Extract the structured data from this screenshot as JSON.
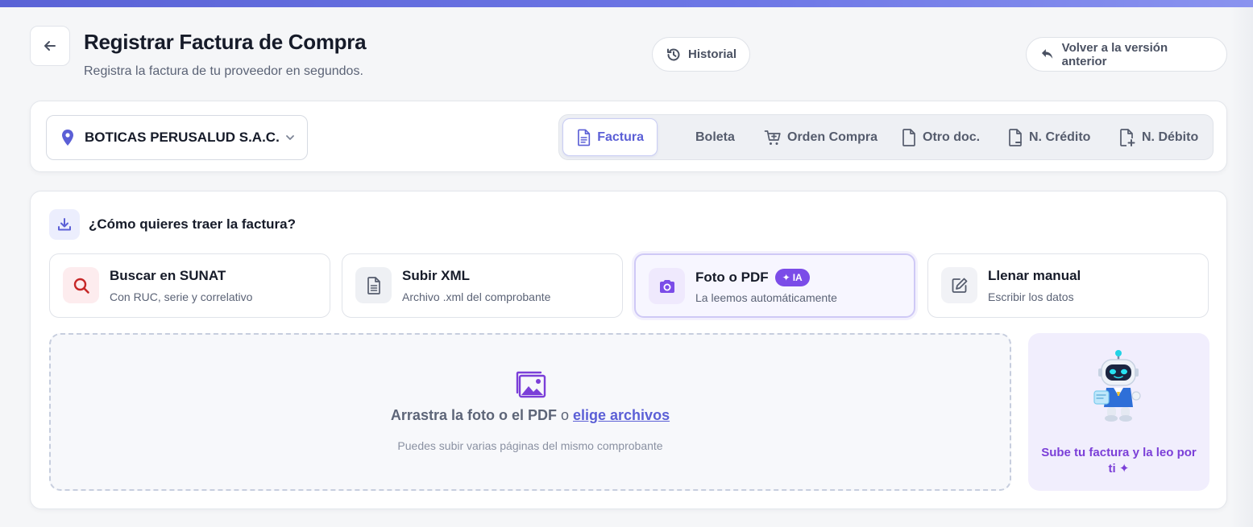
{
  "header": {
    "title": "Registrar Factura de Compra",
    "subtitle": "Registra la factura de tu proveedor en segundos.",
    "history_label": "Historial",
    "revert_label": "Volver a la versión anterior"
  },
  "branch": {
    "name": "BOTICAS PERUSALUD S.A.C."
  },
  "doc_types": [
    {
      "label": "Factura",
      "icon": "document-lines-icon",
      "active": true
    },
    {
      "label": "Boleta",
      "icon": "",
      "active": false
    },
    {
      "label": "Orden Compra",
      "icon": "cart-plus-icon",
      "active": false
    },
    {
      "label": "Otro doc.",
      "icon": "document-icon",
      "active": false
    },
    {
      "label": "N. Crédito",
      "icon": "document-minus-icon",
      "active": false
    },
    {
      "label": "N. Débito",
      "icon": "document-plus-icon",
      "active": false
    }
  ],
  "source": {
    "question": "¿Cómo quieres traer la factura?",
    "methods": [
      {
        "title": "Buscar en SUNAT",
        "subtitle": "Con RUC, serie y correlativo",
        "icon": "search-icon",
        "selected": false
      },
      {
        "title": "Subir XML",
        "subtitle": "Archivo .xml del comprobante",
        "icon": "file-text-icon",
        "selected": false
      },
      {
        "title": "Foto o PDF",
        "subtitle": "La leemos automáticamente",
        "icon": "camera-icon",
        "selected": true,
        "badge": "IA"
      },
      {
        "title": "Llenar manual",
        "subtitle": "Escribir los datos",
        "icon": "edit-icon",
        "selected": false
      }
    ]
  },
  "dropzone": {
    "main_text": "Arrastra la foto o el PDF",
    "or_text": "o",
    "link_text": "elige archivos",
    "sub_text": "Puedes subir varias páginas del mismo comprobante"
  },
  "assistant": {
    "text": "Sube tu factura y la leo por ti ✦"
  },
  "colors": {
    "accent": "#5b5fd6",
    "purple": "#7b4ce8",
    "sunat_red": "#c62828"
  }
}
